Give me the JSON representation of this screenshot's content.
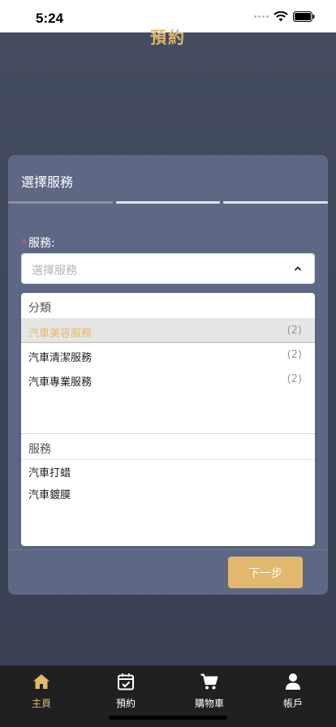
{
  "status_bar": {
    "time": "5:24"
  },
  "header": {
    "title": "預約"
  },
  "panel": {
    "title": "選擇服務",
    "steps": [
      {
        "state": "done"
      },
      {
        "state": "pending"
      },
      {
        "state": "pending"
      }
    ],
    "field_label": "服務:",
    "required_mark": "*",
    "select_placeholder": "選擇服務",
    "dropdown": {
      "category_header": "分類",
      "categories": [
        {
          "label": "汽車美容服務",
          "count": "(2)",
          "active": true
        },
        {
          "label": "汽車清潔服務",
          "count": "(2)",
          "active": false
        },
        {
          "label": "汽車專業服務",
          "count": "(2)",
          "active": false
        }
      ],
      "service_header": "服務",
      "services": [
        {
          "label": "汽車打蜡"
        },
        {
          "label": "汽車鍍膜"
        }
      ]
    },
    "next_label": "下一步"
  },
  "tabs": [
    {
      "label": "主頁",
      "icon": "home-icon",
      "active": true
    },
    {
      "label": "預約",
      "icon": "calendar-check-icon",
      "active": false
    },
    {
      "label": "購物車",
      "icon": "cart-icon",
      "active": false
    },
    {
      "label": "帳戶",
      "icon": "user-icon",
      "active": false
    }
  ],
  "colors": {
    "accent": "#e2b86c",
    "panel": "#5e6884",
    "tabbar": "#202020"
  }
}
